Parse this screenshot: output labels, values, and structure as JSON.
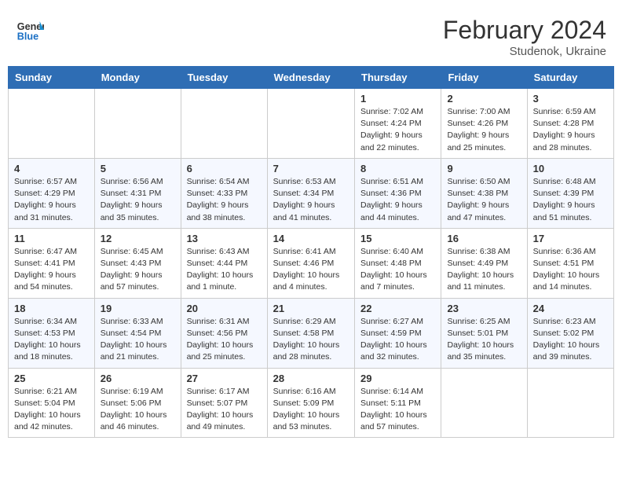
{
  "header": {
    "logo": {
      "line1": "General",
      "line2": "Blue",
      "icon": "▶"
    },
    "title": "February 2024",
    "location": "Studenok, Ukraine"
  },
  "days_of_week": [
    "Sunday",
    "Monday",
    "Tuesday",
    "Wednesday",
    "Thursday",
    "Friday",
    "Saturday"
  ],
  "weeks": [
    [
      {
        "day": "",
        "info": ""
      },
      {
        "day": "",
        "info": ""
      },
      {
        "day": "",
        "info": ""
      },
      {
        "day": "",
        "info": ""
      },
      {
        "day": "1",
        "info": "Sunrise: 7:02 AM\nSunset: 4:24 PM\nDaylight: 9 hours\nand 22 minutes."
      },
      {
        "day": "2",
        "info": "Sunrise: 7:00 AM\nSunset: 4:26 PM\nDaylight: 9 hours\nand 25 minutes."
      },
      {
        "day": "3",
        "info": "Sunrise: 6:59 AM\nSunset: 4:28 PM\nDaylight: 9 hours\nand 28 minutes."
      }
    ],
    [
      {
        "day": "4",
        "info": "Sunrise: 6:57 AM\nSunset: 4:29 PM\nDaylight: 9 hours\nand 31 minutes."
      },
      {
        "day": "5",
        "info": "Sunrise: 6:56 AM\nSunset: 4:31 PM\nDaylight: 9 hours\nand 35 minutes."
      },
      {
        "day": "6",
        "info": "Sunrise: 6:54 AM\nSunset: 4:33 PM\nDaylight: 9 hours\nand 38 minutes."
      },
      {
        "day": "7",
        "info": "Sunrise: 6:53 AM\nSunset: 4:34 PM\nDaylight: 9 hours\nand 41 minutes."
      },
      {
        "day": "8",
        "info": "Sunrise: 6:51 AM\nSunset: 4:36 PM\nDaylight: 9 hours\nand 44 minutes."
      },
      {
        "day": "9",
        "info": "Sunrise: 6:50 AM\nSunset: 4:38 PM\nDaylight: 9 hours\nand 47 minutes."
      },
      {
        "day": "10",
        "info": "Sunrise: 6:48 AM\nSunset: 4:39 PM\nDaylight: 9 hours\nand 51 minutes."
      }
    ],
    [
      {
        "day": "11",
        "info": "Sunrise: 6:47 AM\nSunset: 4:41 PM\nDaylight: 9 hours\nand 54 minutes."
      },
      {
        "day": "12",
        "info": "Sunrise: 6:45 AM\nSunset: 4:43 PM\nDaylight: 9 hours\nand 57 minutes."
      },
      {
        "day": "13",
        "info": "Sunrise: 6:43 AM\nSunset: 4:44 PM\nDaylight: 10 hours\nand 1 minute."
      },
      {
        "day": "14",
        "info": "Sunrise: 6:41 AM\nSunset: 4:46 PM\nDaylight: 10 hours\nand 4 minutes."
      },
      {
        "day": "15",
        "info": "Sunrise: 6:40 AM\nSunset: 4:48 PM\nDaylight: 10 hours\nand 7 minutes."
      },
      {
        "day": "16",
        "info": "Sunrise: 6:38 AM\nSunset: 4:49 PM\nDaylight: 10 hours\nand 11 minutes."
      },
      {
        "day": "17",
        "info": "Sunrise: 6:36 AM\nSunset: 4:51 PM\nDaylight: 10 hours\nand 14 minutes."
      }
    ],
    [
      {
        "day": "18",
        "info": "Sunrise: 6:34 AM\nSunset: 4:53 PM\nDaylight: 10 hours\nand 18 minutes."
      },
      {
        "day": "19",
        "info": "Sunrise: 6:33 AM\nSunset: 4:54 PM\nDaylight: 10 hours\nand 21 minutes."
      },
      {
        "day": "20",
        "info": "Sunrise: 6:31 AM\nSunset: 4:56 PM\nDaylight: 10 hours\nand 25 minutes."
      },
      {
        "day": "21",
        "info": "Sunrise: 6:29 AM\nSunset: 4:58 PM\nDaylight: 10 hours\nand 28 minutes."
      },
      {
        "day": "22",
        "info": "Sunrise: 6:27 AM\nSunset: 4:59 PM\nDaylight: 10 hours\nand 32 minutes."
      },
      {
        "day": "23",
        "info": "Sunrise: 6:25 AM\nSunset: 5:01 PM\nDaylight: 10 hours\nand 35 minutes."
      },
      {
        "day": "24",
        "info": "Sunrise: 6:23 AM\nSunset: 5:02 PM\nDaylight: 10 hours\nand 39 minutes."
      }
    ],
    [
      {
        "day": "25",
        "info": "Sunrise: 6:21 AM\nSunset: 5:04 PM\nDaylight: 10 hours\nand 42 minutes."
      },
      {
        "day": "26",
        "info": "Sunrise: 6:19 AM\nSunset: 5:06 PM\nDaylight: 10 hours\nand 46 minutes."
      },
      {
        "day": "27",
        "info": "Sunrise: 6:17 AM\nSunset: 5:07 PM\nDaylight: 10 hours\nand 49 minutes."
      },
      {
        "day": "28",
        "info": "Sunrise: 6:16 AM\nSunset: 5:09 PM\nDaylight: 10 hours\nand 53 minutes."
      },
      {
        "day": "29",
        "info": "Sunrise: 6:14 AM\nSunset: 5:11 PM\nDaylight: 10 hours\nand 57 minutes."
      },
      {
        "day": "",
        "info": ""
      },
      {
        "day": "",
        "info": ""
      }
    ]
  ]
}
